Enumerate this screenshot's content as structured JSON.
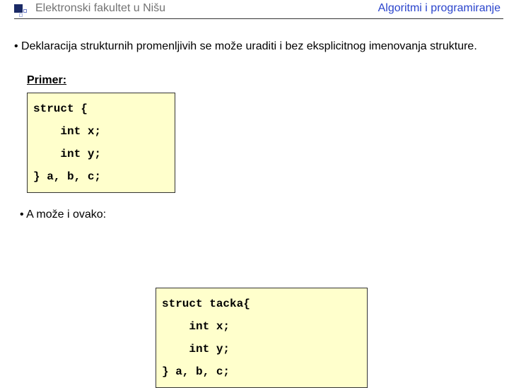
{
  "header": {
    "left": "Elektronski fakultet u Nišu",
    "right": "Algoritmi i programiranje"
  },
  "body": {
    "para": "• Deklaracija strukturnih promenljivih se može uraditi i bez eksplicitnog imenovanja strukture.",
    "primer_label": "Primer:",
    "code1": "struct {\n    int x;\n    int y;\n} a, b, c;",
    "sub_label": "• A može i ovako:",
    "code2": "struct tacka{\n    int x;\n    int y;\n} a, b, c;"
  }
}
